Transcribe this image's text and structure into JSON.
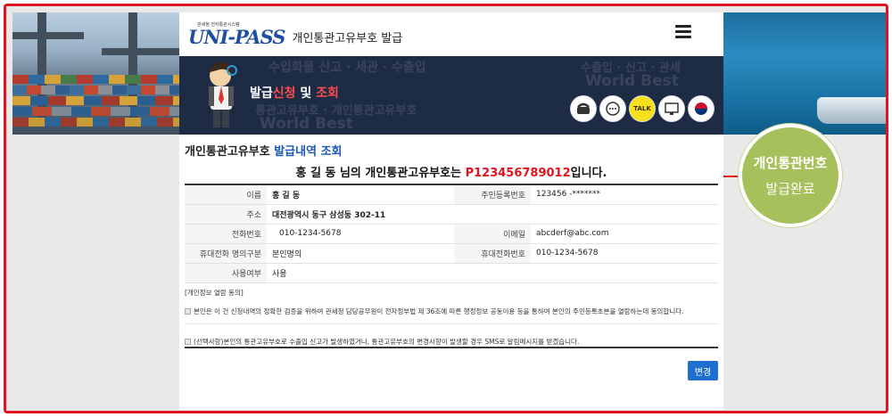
{
  "header": {
    "logo_small_text": "관세청 전자통관시스템",
    "logo_text": "UNI-PASS",
    "page_title": "개인통관고유부호  발급"
  },
  "hero": {
    "title_prefix": "발급",
    "title_red1": "신청",
    "title_mid": " 및 ",
    "title_red2": "조회",
    "icons": [
      "phone-icon",
      "chat-icon",
      "talk-icon",
      "monitor-icon",
      "government-emblem-icon"
    ],
    "talk_label": "TALK"
  },
  "section": {
    "heading_black": "개인통관고유부호 ",
    "heading_blue": "발급내역 조회"
  },
  "result": {
    "prefix": "홍 길 동 님의 개인통관고유부호는 ",
    "number": "P123456789012",
    "suffix": "입니다."
  },
  "info": {
    "name_label": "이름",
    "name_value": "홍 길 동",
    "rrn_label": "주민등록번호",
    "rrn_value": "123456 -*******",
    "address_label": "주소",
    "address_value": "대전광역시 동구 삼성동 302-11",
    "phone_label": "전화번호",
    "phone_value": "010-1234-5678",
    "email_label": "이메일",
    "email_value": "abcderf@abc.com",
    "owner_type_label": "휴대전화 명의구분",
    "owner_type_value": "본인명의",
    "mobile_label": "휴대전화번호",
    "mobile_value": "010-1234-5678",
    "usage_label": "사용여부",
    "usage_value": "사용"
  },
  "consent": {
    "title": "[개인정보 열람 동의]",
    "item1": "본인은 이 건 신청내역의 정확한 검증을 위하여 관세청 담당공무원이 전자정부법 제 36조에 따른 행정정보 공동이용 등을 통하여 본인의 주민등록초본을 열람하는데 동의합니다.",
    "item2": "(선택사항)본인의 통관고유부호로 수출입 신고가 발생하였거나, 통관고유부호의 변경사항이 발생할 경우 SMS로 알림메시지를 받겠습니다."
  },
  "buttons": {
    "change_label": "변경"
  },
  "callout": {
    "line1": "개인통관번호",
    "line2": "발급완료"
  },
  "colors": {
    "frame": "#e0141e",
    "accent_blue": "#1a57b4",
    "button_blue": "#1f6fd1",
    "callout_green": "#a6c15b",
    "hero_navy": "#1d2b44"
  }
}
